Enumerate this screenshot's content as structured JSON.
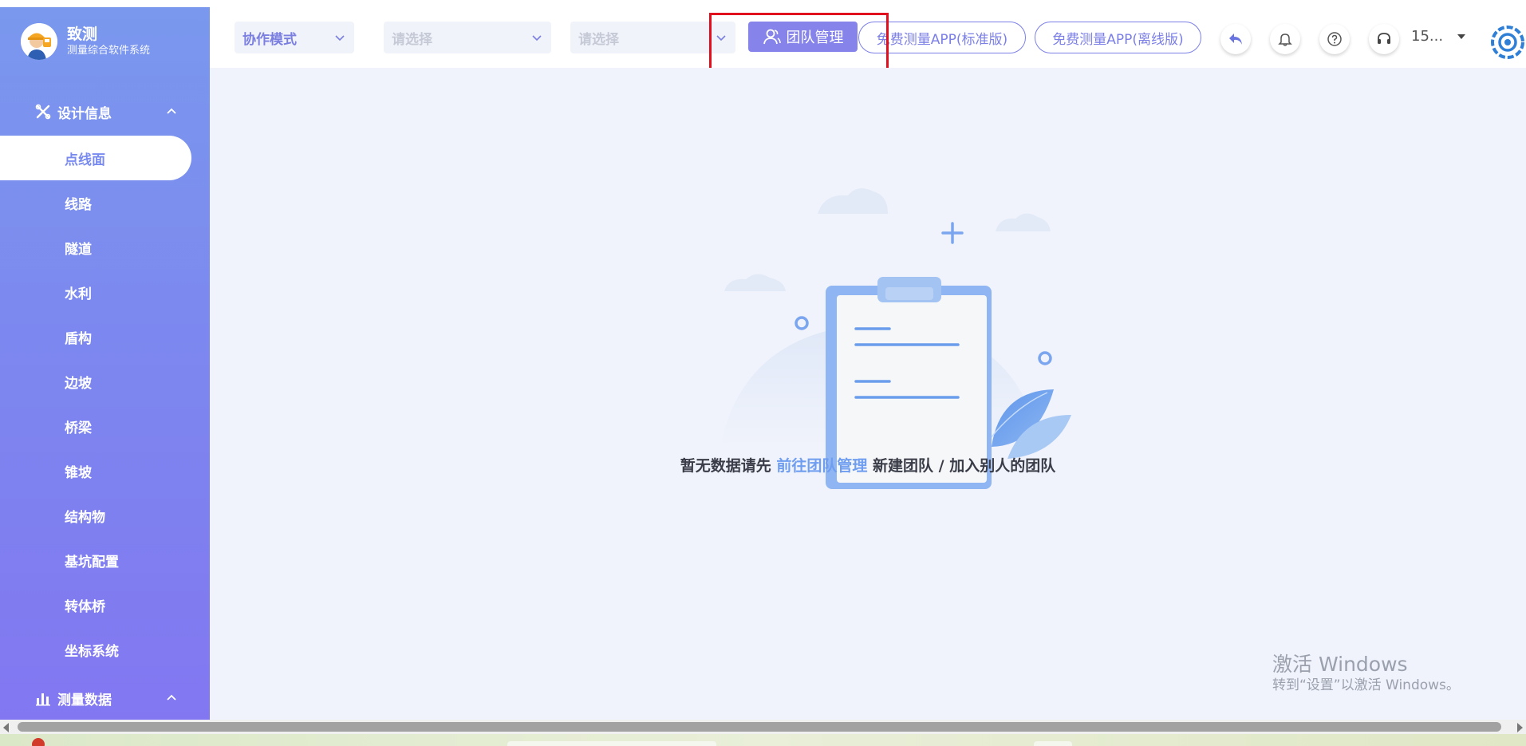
{
  "sidebar": {
    "app_name": "致测",
    "app_subtitle": "测量综合软件系统",
    "section_design": "设计信息",
    "section_measure": "测量数据",
    "items": [
      {
        "label": "点线面"
      },
      {
        "label": "线路"
      },
      {
        "label": "隧道"
      },
      {
        "label": "水利"
      },
      {
        "label": "盾构"
      },
      {
        "label": "边坡"
      },
      {
        "label": "桥梁"
      },
      {
        "label": "锥坡"
      },
      {
        "label": "结构物"
      },
      {
        "label": "基坑配置"
      },
      {
        "label": "转体桥"
      },
      {
        "label": "坐标系统"
      }
    ]
  },
  "topbar": {
    "mode_select": "协作模式",
    "select_placeholder_1": "请选择",
    "select_placeholder_2": "请选择",
    "team_button": "团队管理",
    "app_standard": "免费测量APP(标准版)",
    "app_offline": "免费测量APP(离线版)",
    "user": "15..."
  },
  "main": {
    "empty_prefix": "暂无数据请先 ",
    "empty_link": "前往团队管理",
    "empty_suffix": " 新建团队 / 加入别人的团队"
  },
  "watermark": {
    "line1": "激活 Windows",
    "line2": "转到“设置”以激活 Windows。"
  },
  "colors": {
    "accent": "#8684ea",
    "sidebar_top": "#7a98ee",
    "sidebar_bottom": "#8277f1",
    "main_bg": "#f0f3fb",
    "link": "#6f9ef0",
    "highlight": "#e0101f"
  }
}
